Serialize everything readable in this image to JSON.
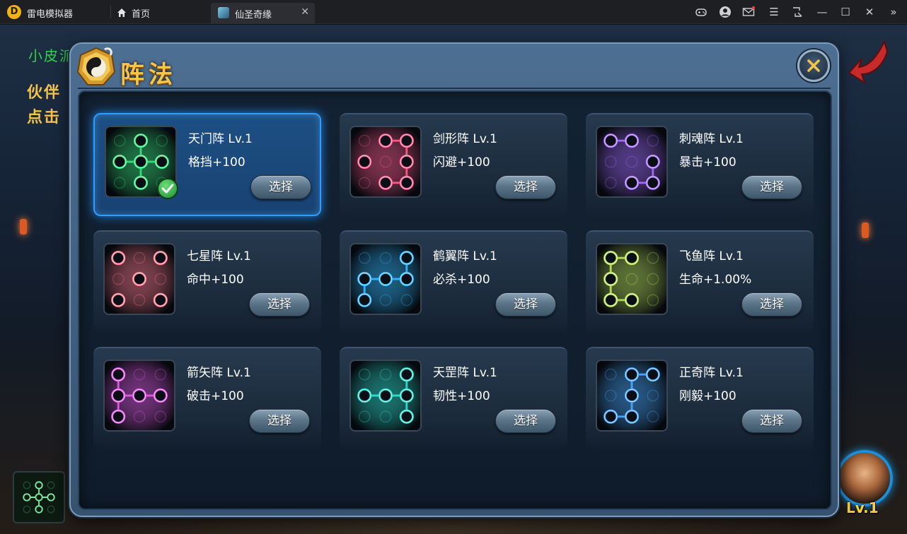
{
  "emulator": {
    "app_name": "雷电模拟器",
    "home_tab": "首页",
    "game_tab": "仙圣奇缘",
    "logo_letter": "D"
  },
  "background": {
    "green_text": "小皮派",
    "yellow_line1": "伙伴",
    "yellow_line2": "点击"
  },
  "panel": {
    "title": "阵法"
  },
  "player": {
    "level": "Lv.1"
  },
  "formations": [
    {
      "name": "天门阵 Lv.1",
      "stat": "格挡+100",
      "button": "选择",
      "selected": true,
      "color": "#36e07a",
      "pattern": [
        1,
        3,
        4,
        5,
        7
      ]
    },
    {
      "name": "剑形阵 Lv.1",
      "stat": "闪避+100",
      "button": "选择",
      "selected": false,
      "color": "#ff5a8c",
      "pattern": [
        1,
        2,
        3,
        5,
        7,
        8
      ]
    },
    {
      "name": "刺魂阵 Lv.1",
      "stat": "暴击+100",
      "button": "选择",
      "selected": false,
      "color": "#a46bff",
      "pattern": [
        0,
        1,
        5,
        7,
        8
      ]
    },
    {
      "name": "七星阵 Lv.1",
      "stat": "命中+100",
      "button": "选择",
      "selected": false,
      "color": "#ff7a8e",
      "pattern": [
        0,
        2,
        4,
        6,
        8
      ]
    },
    {
      "name": "鹤翼阵 Lv.1",
      "stat": "必杀+100",
      "button": "选择",
      "selected": false,
      "color": "#34b8ff",
      "pattern": [
        2,
        3,
        4,
        5,
        6
      ]
    },
    {
      "name": "飞鱼阵 Lv.1",
      "stat": "生命+1.00%",
      "button": "选择",
      "selected": false,
      "color": "#b9e25a",
      "pattern": [
        0,
        1,
        3,
        6,
        7
      ]
    },
    {
      "name": "箭矢阵 Lv.1",
      "stat": "破击+100",
      "button": "选择",
      "selected": false,
      "color": "#e25ae8",
      "pattern": [
        0,
        3,
        4,
        5,
        6
      ]
    },
    {
      "name": "天罡阵 Lv.1",
      "stat": "韧性+100",
      "button": "选择",
      "selected": false,
      "color": "#2ee0d0",
      "pattern": [
        2,
        3,
        4,
        5,
        8
      ]
    },
    {
      "name": "正奇阵 Lv.1",
      "stat": "刚毅+100",
      "button": "选择",
      "selected": false,
      "color": "#4aa8ff",
      "pattern": [
        1,
        2,
        4,
        6,
        7
      ]
    }
  ]
}
